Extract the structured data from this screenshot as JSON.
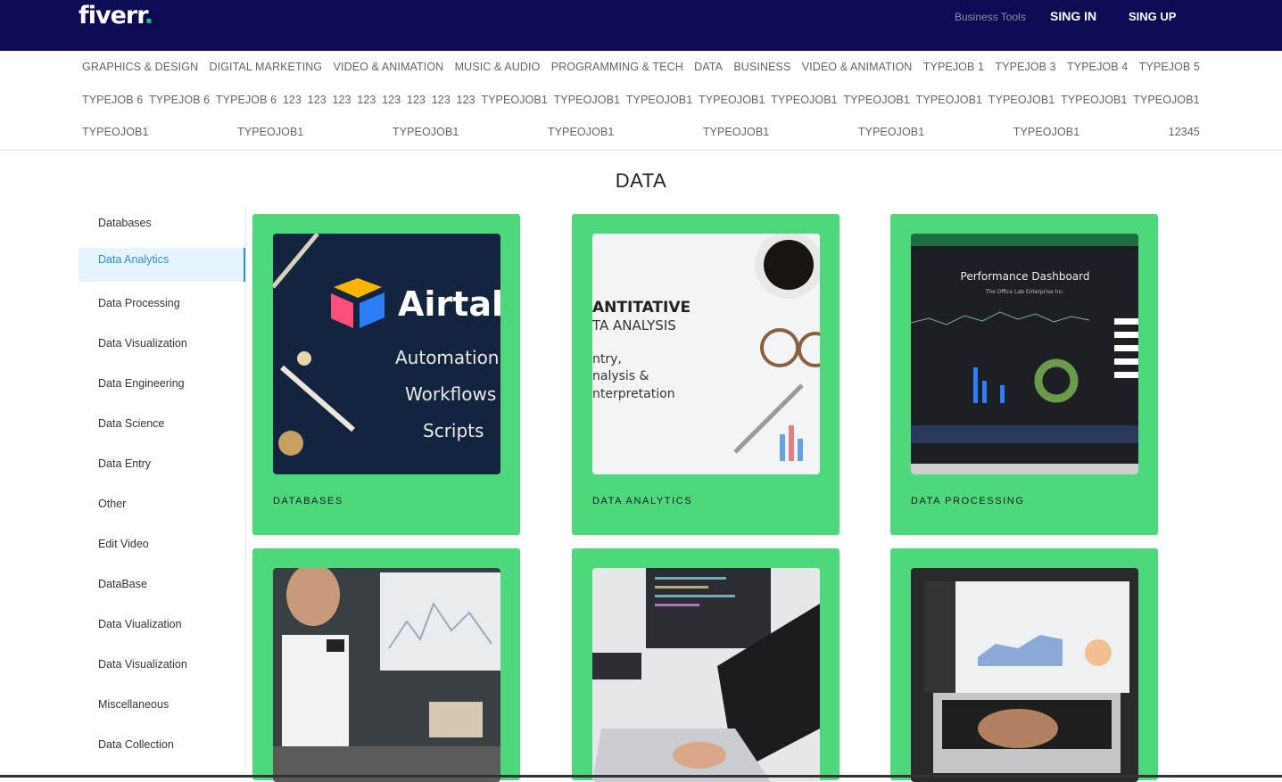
{
  "header": {
    "logo_text": "fiverr",
    "logo_dot": ".",
    "business_tools": "Business Tools",
    "sign_in": "SING IN",
    "sign_up": "SING UP"
  },
  "categories": {
    "row1": [
      "GRAPHICS & DESIGN",
      "DIGITAL MARKETING",
      "VIDEO & ANIMATION",
      "MUSIC & AUDIO",
      "PROGRAMMING & TECH",
      "DATA",
      "BUSINESS",
      "VIDEO & ANIMATION",
      "TYPEJOB 1",
      "TYPEJOB 3",
      "TYPEJOB 4",
      "TYPEJOB 5"
    ],
    "row2": [
      "TYPEJOB 6",
      "TYPEJOB 6",
      "TYPEJOB 6",
      "123",
      "123",
      "123",
      "123",
      "123",
      "123",
      "123",
      "123",
      "TYPEOJOB1",
      "TYPEOJOB1",
      "TYPEOJOB1",
      "TYPEOJOB1",
      "TYPEOJOB1",
      "TYPEOJOB1",
      "TYPEOJOB1",
      "TYPEOJOB1",
      "TYPEOJOB1",
      "TYPEOJOB1"
    ],
    "row3": [
      "TYPEOJOB1",
      "TYPEOJOB1",
      "TYPEOJOB1",
      "TYPEOJOB1",
      "TYPEOJOB1",
      "TYPEOJOB1",
      "TYPEOJOB1",
      "12345"
    ]
  },
  "page_title": "DATA",
  "sidebar": {
    "active_index": 1,
    "items": [
      "Databases",
      "Data Analytics",
      "Data Processing",
      "Data Visualization",
      "Data Engineering",
      "Data Science",
      "Data Entry",
      "Other",
      "Edit Video",
      "DataBase",
      "Data Viualization",
      "Data Visualization",
      "Miscellaneous",
      "Data Collection"
    ]
  },
  "cards": [
    {
      "caption": "DATABASES",
      "image": "airtable-automation-image",
      "image_text": [
        "Airtab",
        "Automation",
        "Workflows",
        "Scripts"
      ]
    },
    {
      "caption": "DATA ANALYTICS",
      "image": "quantitative-data-analysis-image",
      "image_text": [
        "ANTITATIVE",
        "TA ANALYSIS",
        "ntry,",
        "nalysis &",
        "nterpretation"
      ]
    },
    {
      "caption": "DATA PROCESSING",
      "image": "performance-dashboard-image",
      "image_text": [
        "Performance Dashboard",
        "The Office Lab Enterprise Inc."
      ]
    },
    {
      "caption": "",
      "image": "analyst-at-monitors-image"
    },
    {
      "caption": "",
      "image": "laptop-coding-image"
    },
    {
      "caption": "",
      "image": "laptop-analytics-image"
    }
  ],
  "colors": {
    "header_bg": "#0e0b55",
    "card_bg": "#4cd87b",
    "active_sidebar_bg": "#e6f5fd",
    "active_sidebar_text": "#2b8ddb"
  }
}
